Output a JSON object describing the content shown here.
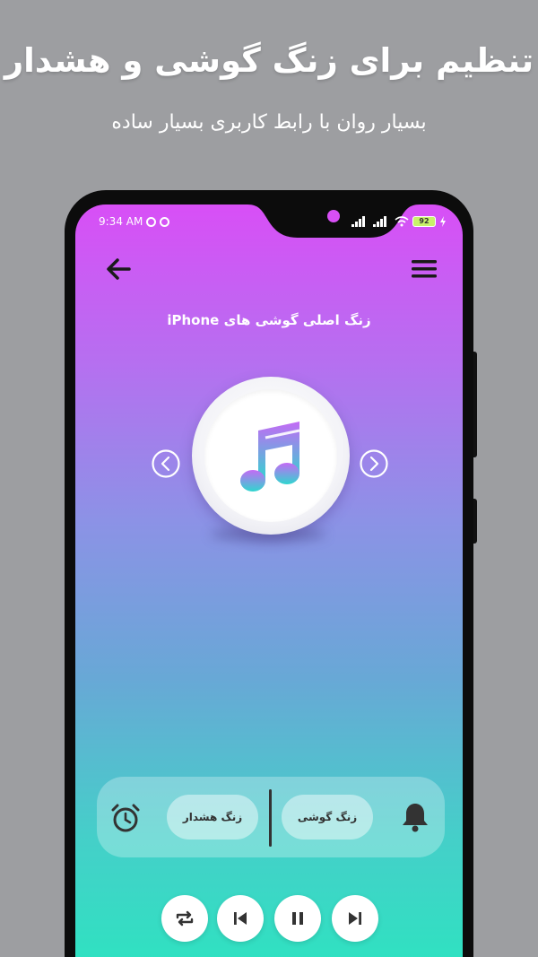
{
  "promo": {
    "title": "تنظیم برای زنگ گوشی و هشدار",
    "subtitle": "بسیار روان با رابط کاربری بسیار ساده"
  },
  "status_bar": {
    "time": "9:34 AM",
    "battery": "92"
  },
  "header": {
    "back_icon": "arrow-left-icon",
    "menu_icon": "hamburger-menu-icon"
  },
  "track": {
    "title": "زنگ اصلی گوشی های iPhone",
    "artwork_icon": "music-note-icon"
  },
  "actions": {
    "alarm_label": "زنگ هشدار",
    "ringtone_label": "زنگ گوشی"
  },
  "player": {
    "buttons": [
      "repeat-icon",
      "previous-icon",
      "pause-icon",
      "next-icon"
    ]
  },
  "colors": {
    "gradient_top": "#d84ff6",
    "gradient_bottom": "#2ae6bf",
    "background": "#9d9ea1"
  }
}
